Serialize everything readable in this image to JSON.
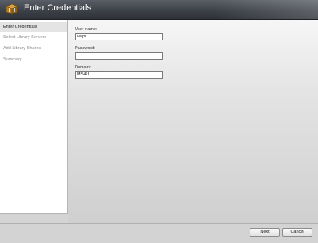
{
  "window": {
    "title": "Enter Credentials",
    "icon": "wizard-box-icon"
  },
  "steps": [
    {
      "label": "Enter Credentials",
      "active": true
    },
    {
      "label": "Select Library Servers",
      "active": false
    },
    {
      "label": "Add Library Shares",
      "active": false
    },
    {
      "label": "Summary",
      "active": false
    }
  ],
  "form": {
    "username_label": "User name:",
    "username_value": "vays",
    "password_label": "Password:",
    "password_value": "",
    "domain_label": "Domain:",
    "domain_value": "MS4U"
  },
  "buttons": {
    "next": "Next",
    "cancel": "Cancel"
  }
}
